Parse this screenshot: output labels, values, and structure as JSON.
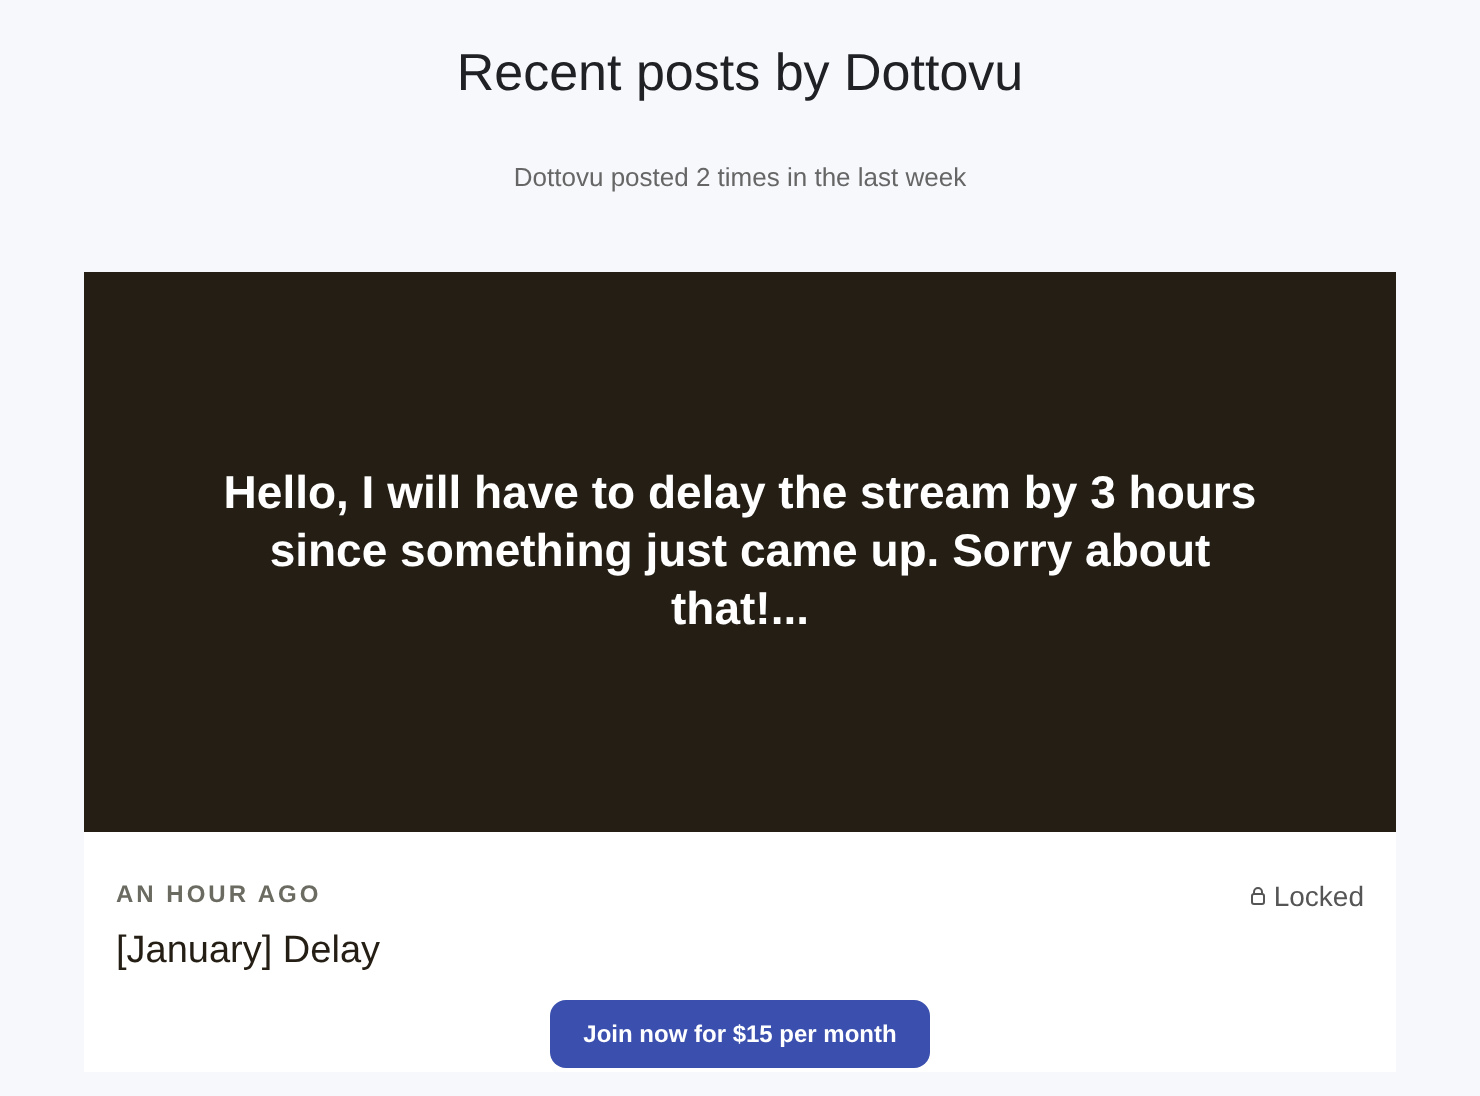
{
  "header": {
    "title": "Recent posts by Dottovu",
    "subtitle": "Dottovu posted 2 times in the last week"
  },
  "post": {
    "preview": "Hello, I will have to delay the stream by 3 hours since something just came up. Sorry about that!...",
    "time": "AN HOUR AGO",
    "status": "Locked",
    "locked": true,
    "title": "[January] Delay",
    "button": "Join now for $15 per month"
  }
}
